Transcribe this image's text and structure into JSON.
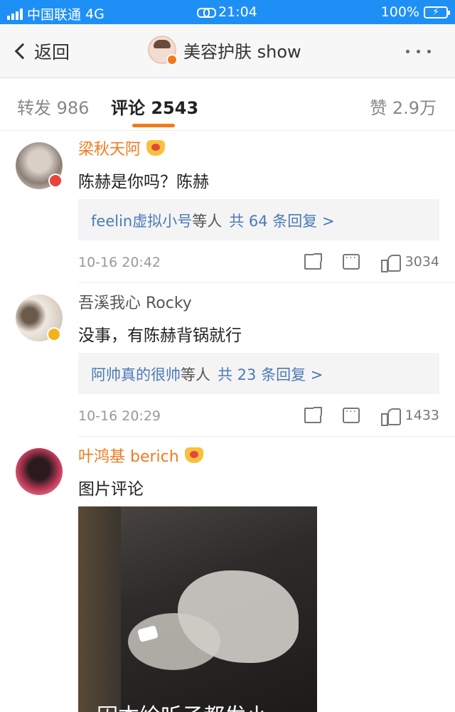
{
  "status_bar": {
    "carrier": "中国联通",
    "network": "4G",
    "time": "21:04",
    "battery": "100%"
  },
  "nav": {
    "back_label": "返回",
    "title": "美容护肤 show"
  },
  "tabs": {
    "repost": "转发 986",
    "comment": "评论 2543",
    "like": "赞 2.9万"
  },
  "comments": [
    {
      "author": "梁秋天阿",
      "text": "陈赫是你吗？陈赫",
      "reply_names": "feelin虚拟小号",
      "reply_suffix": "等人",
      "reply_count": "共 64 条回复 >",
      "time": "10-16 20:42",
      "likes": "3034"
    },
    {
      "author": "吾溪我心 Rocky",
      "text": "没事，有陈赫背锅就行",
      "reply_names": "阿帅真的很帅",
      "reply_suffix": "等人",
      "reply_count": "共 23 条回复 >",
      "time": "10-16 20:29",
      "likes": "1433"
    },
    {
      "author": "叶鸿基 berich",
      "text": "图片评论",
      "photo_caption": "因本绘听子都发小"
    }
  ],
  "colors": {
    "status_bar": "#1e90f5",
    "accent": "#f27a1c",
    "link": "#4a7ab8"
  }
}
